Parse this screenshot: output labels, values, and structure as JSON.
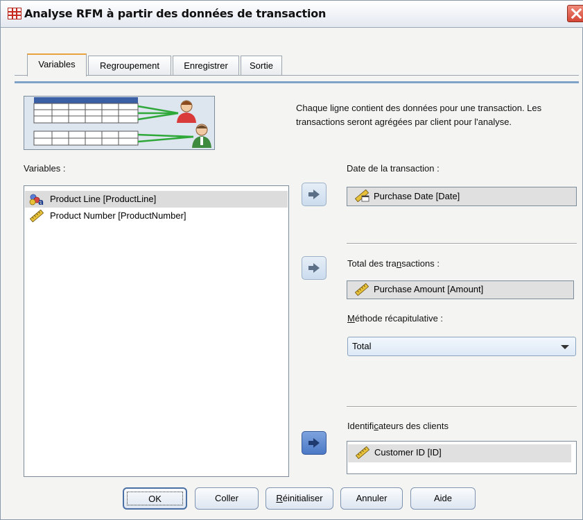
{
  "window": {
    "title": "Analyse RFM à partir des données de transaction"
  },
  "tabs": [
    {
      "label": "Variables",
      "active": true
    },
    {
      "label": "Regroupement",
      "active": false
    },
    {
      "label": "Enregistrer",
      "active": false
    },
    {
      "label": "Sortie",
      "active": false
    }
  ],
  "description": "Chaque ligne contient des données pour une transaction. Les transactions seront agrégées par client pour l'analyse.",
  "variables": {
    "label": "Variables :",
    "items": [
      {
        "label": "Product Line [ProductLine]",
        "icon": "nominal-variable-icon",
        "selected": true
      },
      {
        "label": "Product Number [ProductNumber]",
        "icon": "scale-variable-icon",
        "selected": false
      }
    ]
  },
  "transaction_date": {
    "label": "Date de la transaction :",
    "value": "Purchase Date [Date]",
    "icon": "date-scale-icon"
  },
  "transaction_total": {
    "label": "Total des transactions :",
    "value": "Purchase Amount [Amount]",
    "icon": "scale-variable-icon"
  },
  "summary_method": {
    "label": "Méthode récapitulative :",
    "value": "Total"
  },
  "customer_ids": {
    "label": "Identificateurs des clients",
    "value": "Customer ID [ID]",
    "icon": "scale-variable-icon"
  },
  "buttons": {
    "ok": "OK",
    "paste": "Coller",
    "reset": "Réinitialiser",
    "cancel": "Annuler",
    "help": "Aide"
  },
  "colors": {
    "accent": "#e8a33d",
    "selection": "#dcdcdc",
    "arrow_active": "#4b78c6",
    "close": "#d44634"
  }
}
